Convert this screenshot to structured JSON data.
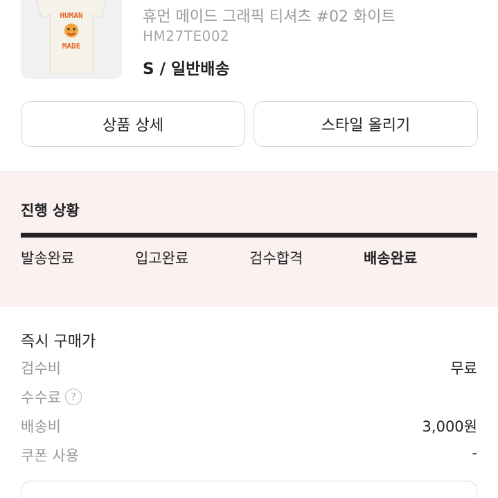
{
  "product": {
    "name": "휴먼 메이드 그래픽 티셔츠 #02 화이트",
    "code": "HM27TE002",
    "option": "S / 일반배송",
    "image_text": [
      "HUMAN",
      "MADE"
    ]
  },
  "buttons": {
    "detail": "상품 상세",
    "style": "스타일 올리기"
  },
  "progress": {
    "title": "진행 상황",
    "steps": [
      "발송완료",
      "입고완료",
      "검수합격",
      "배송완료"
    ],
    "current_step": "배송완료"
  },
  "price": {
    "title": "즉시 구매가",
    "rows": [
      {
        "label": "검수비",
        "value": "무료"
      },
      {
        "label": "수수료",
        "value": "",
        "help": "?"
      },
      {
        "label": "배송비",
        "value": "3,000원"
      },
      {
        "label": "쿠폰 사용",
        "value": "-"
      }
    ]
  },
  "colors": {
    "progress_bg": "#fbf1f1",
    "accent": "#e8652a"
  },
  "icons": {
    "help": "help-circle-icon"
  }
}
